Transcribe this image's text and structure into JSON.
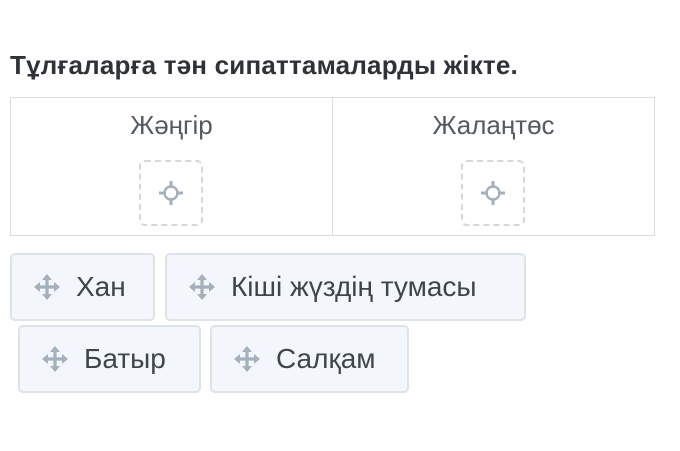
{
  "instruction": "Тұлғаларға тән сипаттамаларды жікте.",
  "categories": [
    {
      "label": "Жәңгір"
    },
    {
      "label": "Жалаңтөс"
    }
  ],
  "tokens": [
    {
      "label": "Хан"
    },
    {
      "label": "Кіші жүздің тумасы"
    },
    {
      "label": "Батыр"
    },
    {
      "label": "Салқам"
    }
  ],
  "colors": {
    "token_background": "#f3f7fb",
    "token_border": "#dde3e8",
    "icon": "#a4b0bb",
    "drop_zone_border": "#d3d8dc"
  },
  "icons": {
    "token": "move-arrows-icon",
    "drop_zone": "drop-target-icon"
  }
}
